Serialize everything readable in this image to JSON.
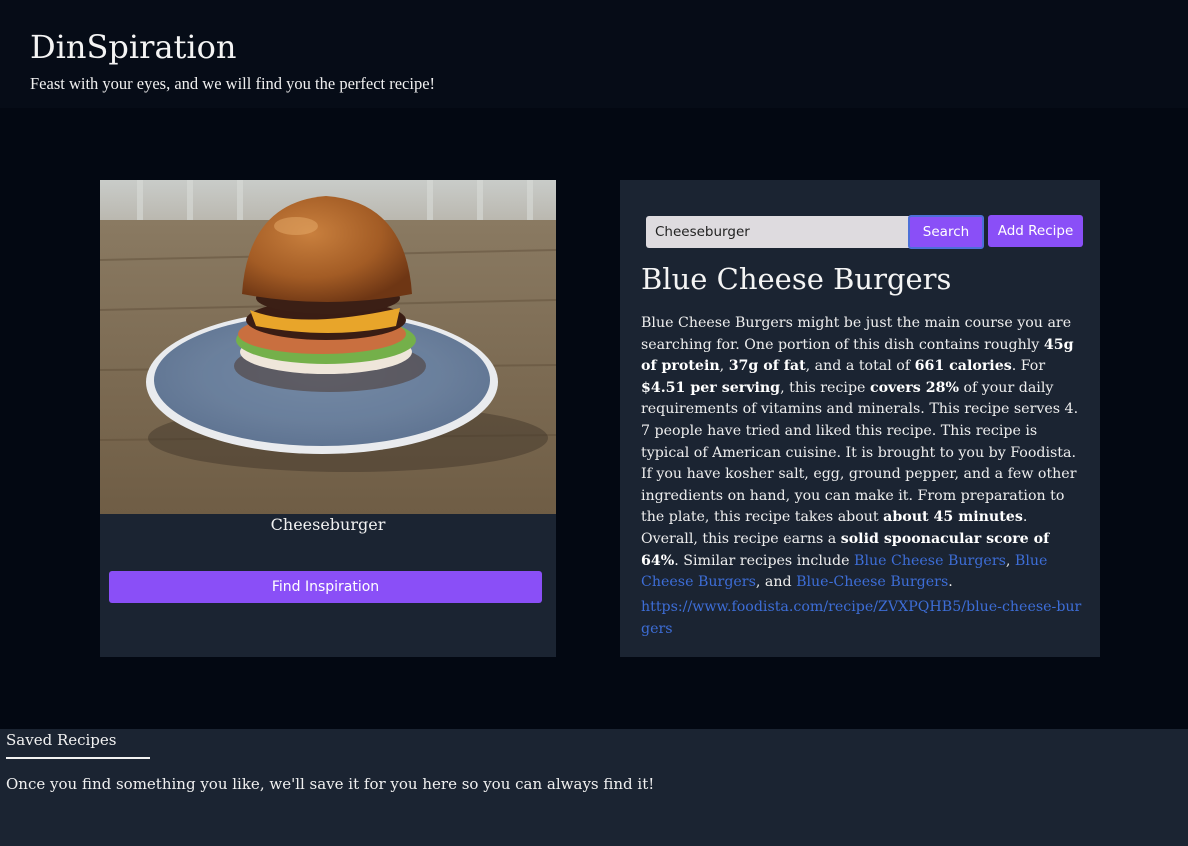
{
  "header": {
    "title": "DinSpiration",
    "tagline": "Feast with your eyes, and we will find you the perfect recipe!"
  },
  "inspiration": {
    "image_subject": "cheeseburger on a blue plate",
    "caption": "Cheeseburger",
    "button_label": "Find Inspiration"
  },
  "search": {
    "input_value": "Cheeseburger",
    "search_label": "Search",
    "add_label": "Add Recipe"
  },
  "recipe": {
    "title": "Blue Cheese Burgers",
    "summary": {
      "s1": "Blue Cheese Burgers might be just the main course you are searching for. One portion of this dish contains roughly ",
      "protein": "45g of protein",
      "s2": ", ",
      "fat": "37g of fat",
      "s3": ", and a total of ",
      "calories": "661 calories",
      "s4": ". For ",
      "price": "$4.51 per serving",
      "s5": ", this recipe ",
      "covers": "covers 28%",
      "s6": " of your daily requirements of vitamins and minerals. This recipe serves 4. 7 people have tried and liked this recipe. This recipe is typical of American cuisine. It is brought to you by Foodista. If you have kosher salt, egg, ground pepper, and a few other ingredients on hand, you can make it. From preparation to the plate, this recipe takes about ",
      "time": "about 45 minutes",
      "s7": ". Overall, this recipe earns a ",
      "score": "solid spoonacular score of 64%",
      "s8": ". Similar recipes include ",
      "similar1": "Blue Cheese Burgers",
      "s9": ", ",
      "similar2": "Blue Cheese Burgers",
      "s10": ", and ",
      "similar3": "Blue-Cheese Burgers",
      "s11": "."
    },
    "source_url": "https://www.foodista.com/recipe/ZVXPQHB5/blue-cheese-burgers"
  },
  "saved": {
    "heading": "Saved Recipes",
    "empty_message": "Once you find something you like, we'll save it for you here so you can always find it!"
  },
  "colors": {
    "accent": "#8a4ff7",
    "link": "#3d6dd6",
    "card_bg": "#1b2432",
    "page_bg": "#030812"
  }
}
